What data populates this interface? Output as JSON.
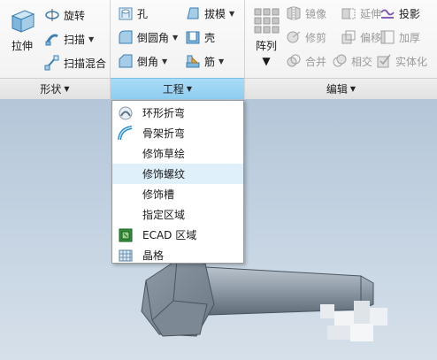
{
  "ribbon": {
    "shape_group": {
      "label": "形状",
      "extrude": "拉伸",
      "revolve": "旋转",
      "sweep": "扫描",
      "swept_blend": "扫描混合"
    },
    "engineering_group": {
      "label": "工程",
      "hole": "孔",
      "draft": "拔模",
      "round": "倒圆角",
      "shell": "壳",
      "chamfer": "倒角",
      "rib": "筋"
    },
    "edit_group": {
      "label": "编辑",
      "pattern": "阵列",
      "mirror": "镜像",
      "extend": "延伸",
      "project": "投影",
      "trim": "修剪",
      "offset": "偏移",
      "thicken": "加厚",
      "merge": "合并",
      "intersect": "相交",
      "solidify": "实体化"
    }
  },
  "engineering_menu": {
    "items": [
      {
        "label": "环形折弯",
        "icon": "toroidal-bend-icon"
      },
      {
        "label": "骨架折弯",
        "icon": "spinal-bend-icon"
      },
      {
        "label": "修饰草绘",
        "icon": ""
      },
      {
        "label": "修饰螺纹",
        "icon": ""
      },
      {
        "label": "修饰槽",
        "icon": ""
      },
      {
        "label": "指定区域",
        "icon": ""
      },
      {
        "label": "ECAD 区域",
        "icon": "ecad-area-icon"
      },
      {
        "label": "晶格",
        "icon": "lattice-icon"
      }
    ],
    "highlighted_index": 3
  },
  "colors": {
    "engineering_tab_active": "#8fcdf0",
    "menu_highlight": "#dff0fb",
    "background": "#c3d2e1"
  }
}
